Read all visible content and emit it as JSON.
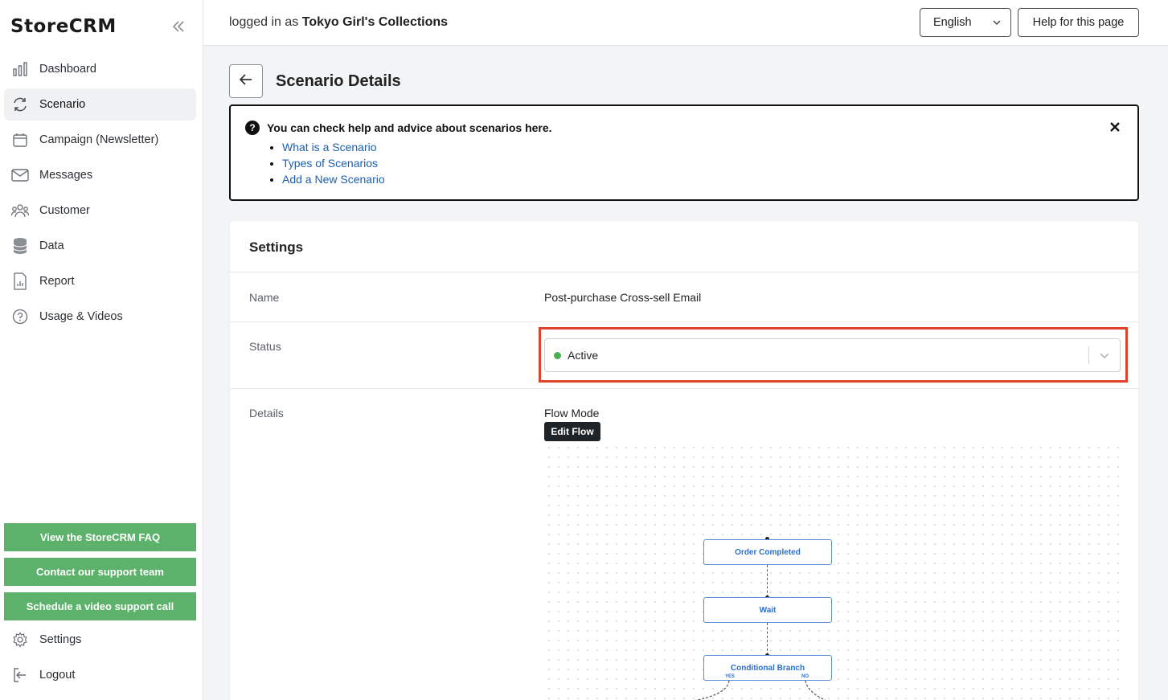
{
  "sidebar": {
    "logo": "StoreCRM",
    "items": [
      {
        "label": "Dashboard",
        "icon": "bar-chart-icon"
      },
      {
        "label": "Scenario",
        "icon": "refresh-icon"
      },
      {
        "label": "Campaign (Newsletter)",
        "icon": "calendar-icon"
      },
      {
        "label": "Messages",
        "icon": "mail-icon"
      },
      {
        "label": "Customer",
        "icon": "users-icon"
      },
      {
        "label": "Data",
        "icon": "database-icon"
      },
      {
        "label": "Report",
        "icon": "report-icon"
      },
      {
        "label": "Usage & Videos",
        "icon": "help-circle-icon"
      }
    ],
    "buttons": {
      "faq": "View the StoreCRM FAQ",
      "support": "Contact our support team",
      "video": "Schedule a video support call"
    },
    "bottom_items": [
      {
        "label": "Settings",
        "icon": "gear-icon"
      },
      {
        "label": "Logout",
        "icon": "logout-icon"
      }
    ]
  },
  "header": {
    "login_prefix": "logged in as ",
    "store_name": "Tokyo Girl's Collections",
    "language": "English",
    "help_button": "Help for this page"
  },
  "page": {
    "title": "Scenario Details"
  },
  "help_box": {
    "title": "You can check help and advice about scenarios here.",
    "links": [
      "What is a Scenario",
      "Types of Scenarios",
      "Add a New Scenario"
    ]
  },
  "settings": {
    "title": "Settings",
    "name_label": "Name",
    "name_value": "Post-purchase Cross-sell Email",
    "status_label": "Status",
    "status_value": "Active",
    "details_label": "Details",
    "flow_mode": "Flow Mode",
    "edit_flow": "Edit Flow"
  },
  "flow": {
    "nodes": [
      "Order Completed",
      "Wait",
      "Conditional Branch"
    ],
    "branch_yes": "YES",
    "branch_no": "NO"
  },
  "colors": {
    "accent_green": "#5cb26b",
    "highlight_red": "#e0422c",
    "link_blue": "#1a5fb4",
    "status_green": "#4caf50"
  }
}
